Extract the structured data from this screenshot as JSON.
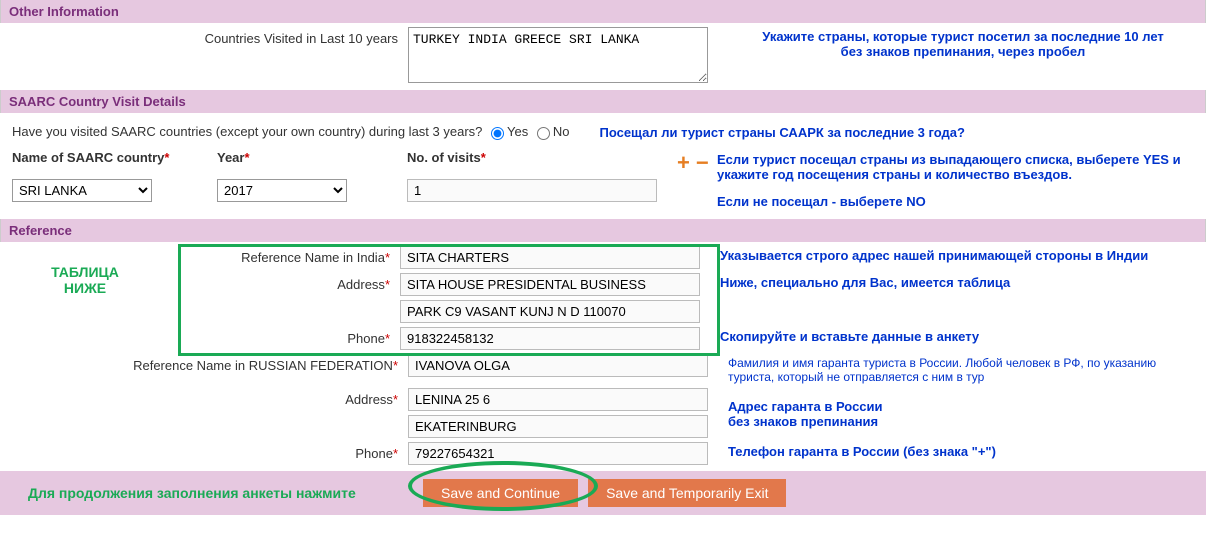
{
  "other_info": {
    "header": "Other Information",
    "countries_label": "Countries Visited in Last 10 years",
    "countries_value": "TURKEY INDIA GREECE SRI LANKA",
    "hint_line1": "Укажите страны, которые турист посетил за последние 10 лет",
    "hint_line2": "без знаков препинания, через пробел"
  },
  "saarc": {
    "header": "SAARC Country Visit Details",
    "question": "Have you visited SAARC countries (except your own country) during last 3 years?",
    "yes": "Yes",
    "no": "No",
    "hint_q": "Посещал ли турист страны СААРК за последние 3 года?",
    "col_country": "Name of SAARC country",
    "col_year": "Year",
    "col_visits": "No. of visits",
    "country_value": "SRI LANKA",
    "year_value": "2017",
    "visits_value": "1",
    "hint_l1": "Если турист посещал страны из выпадающего списка, выберете YES и",
    "hint_l2": "укажите год посещения страны и количество въездов.",
    "hint_l3": "Если не посещал - выберете NO"
  },
  "reference": {
    "header": "Reference",
    "tablica1": "ТАБЛИЦА",
    "tablica2": "НИЖЕ",
    "name_india_label": "Reference Name in India",
    "name_india_value": "SITA CHARTERS",
    "address_label": "Address",
    "address_india_l1": "SITA HOUSE PRESIDENTAL BUSINESS",
    "address_india_l2": "PARK C9 VASANT KUNJ N D 110070",
    "phone_label": "Phone",
    "phone_india_value": "918322458132",
    "name_ru_label": "Reference Name in RUSSIAN FEDERATION",
    "name_ru_value": "IVANOVA OLGA",
    "address_ru_l1": "LENINA 25 6",
    "address_ru_l2": "EKATERINBURG",
    "phone_ru_value": "79227654321",
    "hint_india1": "Указывается строго адрес нашей принимающей стороны в Индии",
    "hint_india2": "Ниже, специально для Вас, имеется таблица",
    "hint_india3": "Скопируйте и вставьте данные в анкету",
    "hint_ru_name": "Фамилия и имя гаранта туриста в России. Любой человек в РФ, по указанию туриста, который не отправляется с ним в тур",
    "hint_ru_addr1": "Адрес гаранта в России",
    "hint_ru_addr2": "без знаков препинания",
    "hint_ru_phone": "Телефон гаранта в России (без знака \"+\")"
  },
  "footer": {
    "hint": "Для продолжения заполнения анкеты нажмите",
    "save_continue": "Save and Continue",
    "save_exit": "Save and Temporarily Exit"
  }
}
